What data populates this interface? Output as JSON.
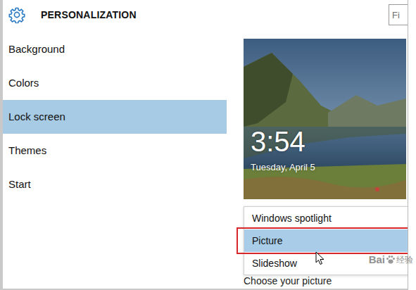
{
  "window": {
    "title": "PERSONALIZATION"
  },
  "search": {
    "placeholder": "Fi"
  },
  "sidebar": {
    "items": [
      {
        "label": "Background",
        "selected": false
      },
      {
        "label": "Colors",
        "selected": false
      },
      {
        "label": "Lock screen",
        "selected": true
      },
      {
        "label": "Themes",
        "selected": false
      },
      {
        "label": "Start",
        "selected": false
      }
    ]
  },
  "preview": {
    "time": "3:54",
    "date": "Tuesday, April 5"
  },
  "dropdown": {
    "options": [
      {
        "label": "Windows spotlight",
        "selected": false,
        "annotated": false
      },
      {
        "label": "Picture",
        "selected": true,
        "annotated": true
      },
      {
        "label": "Slideshow",
        "selected": false,
        "annotated": false
      }
    ]
  },
  "section": {
    "label": "Choose your picture"
  },
  "watermark": {
    "brand": "Bai",
    "suffix": "经验"
  }
}
